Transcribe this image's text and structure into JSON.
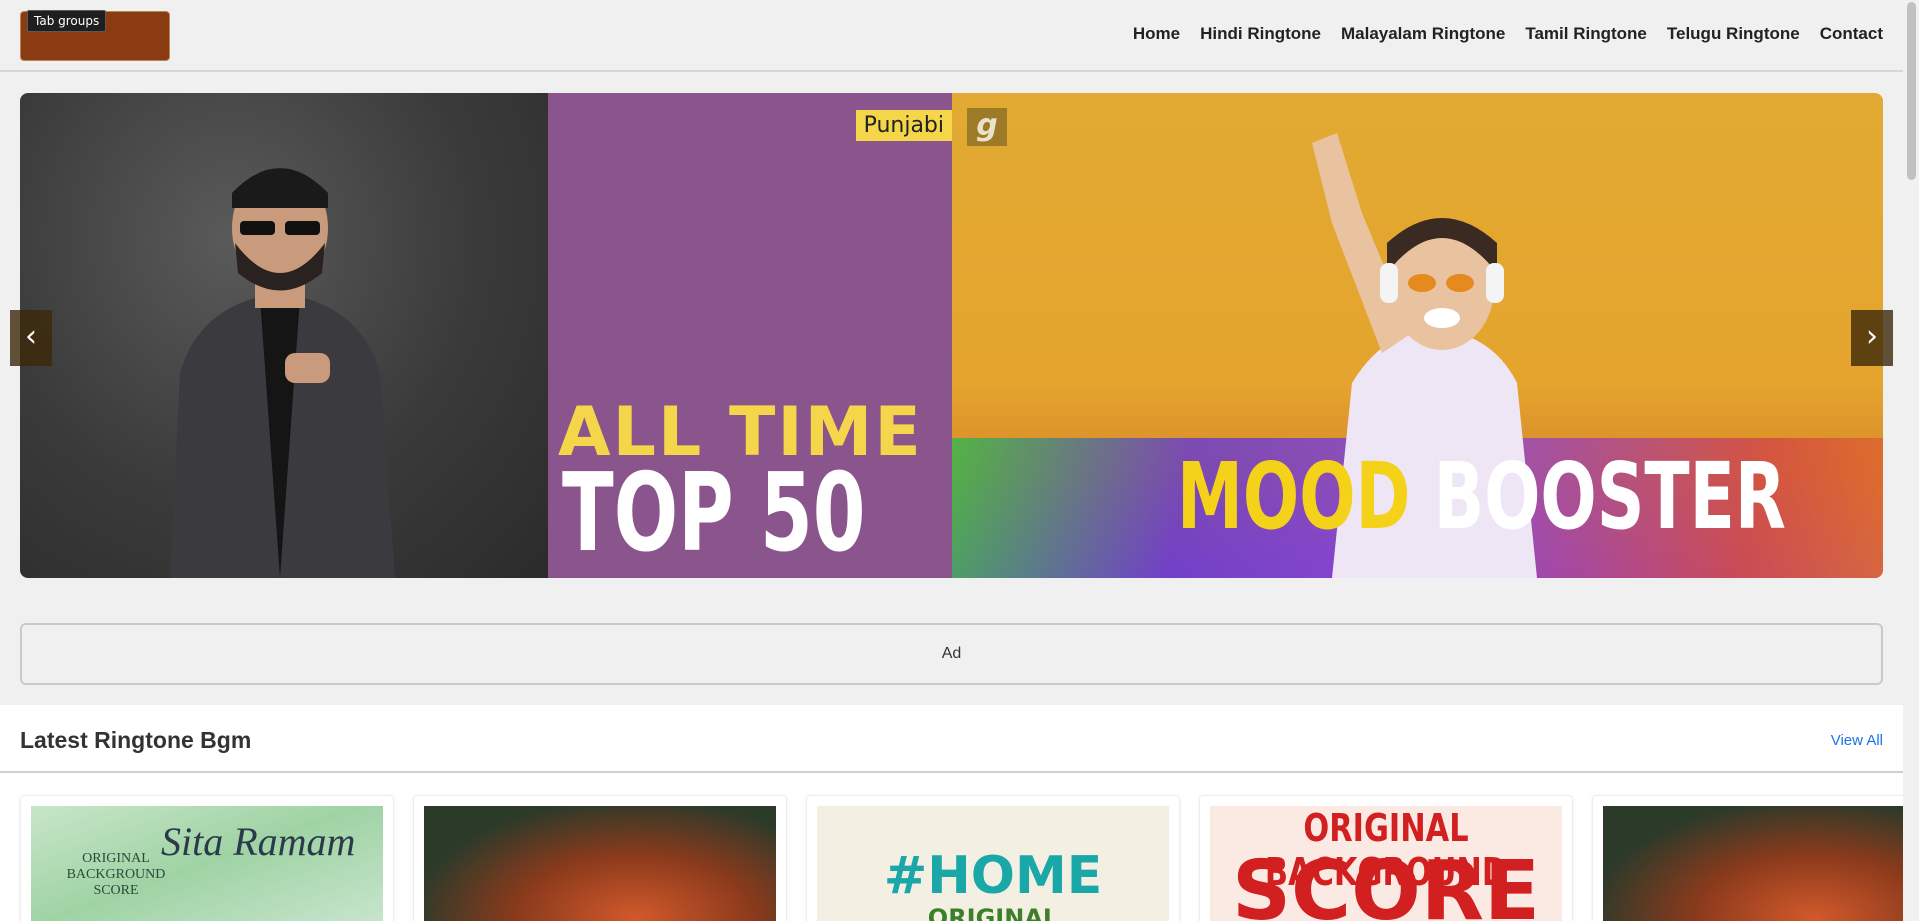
{
  "browser": {
    "tab_groups_label": "Tab groups"
  },
  "header": {
    "nav": [
      "Home",
      "Hindi Ringtone",
      "Malayalam Ringtone",
      "Tamil Ringtone",
      "Telugu Ringtone",
      "Contact"
    ]
  },
  "carousel": {
    "slide1": {
      "tag": "Punjabi",
      "line1": "ALL TIME",
      "line2": "TOP 50"
    },
    "slide2": {
      "badge": "g",
      "word1": "MOOD",
      "word2": "BOOSTER"
    },
    "prev": "‹",
    "next": "›"
  },
  "ad": {
    "label": "Ad"
  },
  "latest": {
    "title": "Latest Ringtone Bgm",
    "view_all": "View All",
    "cards": [
      {
        "line1": "ORIGINAL BACKGROUND SCORE",
        "line2": "Sita Ramam"
      },
      {
        "line1": "",
        "line2": ""
      },
      {
        "line1": "#HOME",
        "line2": "ORIGINAL"
      },
      {
        "line1": "ORIGINAL BACKGROUND",
        "line2": "SCORE"
      },
      {
        "line1": "",
        "line2": ""
      }
    ]
  },
  "colors": {
    "logo": "#8b3b12",
    "slide1_panel": "#8a548c",
    "slide2_bg": "#e2aa33",
    "link": "#1a73e8"
  }
}
